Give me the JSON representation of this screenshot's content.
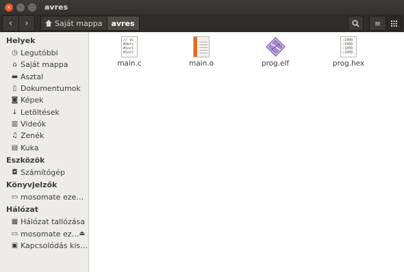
{
  "window": {
    "title": "avres",
    "close_glyph": "×",
    "minimize_glyph": "–",
    "maximize_glyph": "▢"
  },
  "toolbar": {
    "back_icon": "‹",
    "forward_icon": "›",
    "breadcrumbs": [
      "Saját mappa",
      "avres"
    ],
    "search_icon": "search-icon",
    "list_view_glyph": "≡",
    "grid_view_glyph": "⋮⋮"
  },
  "sidebar": {
    "sections": [
      {
        "title": "Helyek",
        "items": [
          {
            "label": "Legutóbbi",
            "icon": "clock-icon",
            "glyph": "◷"
          },
          {
            "label": "Saját mappa",
            "icon": "home-icon",
            "glyph": "⌂"
          },
          {
            "label": "Asztal",
            "icon": "desktop-icon",
            "glyph": "▬"
          },
          {
            "label": "Dokumentumok",
            "icon": "document-icon",
            "glyph": "▯"
          },
          {
            "label": "Képek",
            "icon": "camera-icon",
            "glyph": "◙"
          },
          {
            "label": "Letöltések",
            "icon": "download-icon",
            "glyph": "↓"
          },
          {
            "label": "Videók",
            "icon": "film-icon",
            "glyph": "▥"
          },
          {
            "label": "Zenék",
            "icon": "music-icon",
            "glyph": "♫"
          },
          {
            "label": "Kuka",
            "icon": "trash-icon",
            "glyph": "▤"
          }
        ]
      },
      {
        "title": "Eszközök",
        "items": [
          {
            "label": "Számítógép",
            "icon": "drive-icon",
            "glyph": "◘"
          }
        ]
      },
      {
        "title": "Könyvjelzők",
        "items": [
          {
            "label": "mosomate ezen: m…",
            "icon": "folder-icon",
            "glyph": "▭"
          }
        ]
      },
      {
        "title": "Hálózat",
        "items": [
          {
            "label": "Hálózat tallózása",
            "icon": "network-icon",
            "glyph": "▦"
          },
          {
            "label": "mosomate ez…",
            "icon": "folder-icon",
            "glyph": "▭",
            "eject": "⏏"
          },
          {
            "label": "Kapcsolódás kiszo…",
            "icon": "server-icon",
            "glyph": "▣"
          }
        ]
      }
    ]
  },
  "files": [
    {
      "name": "main.c",
      "type": "c-source",
      "preview": "// Vi\n#defi\n#incl\n#incl"
    },
    {
      "name": "main.o",
      "type": "object"
    },
    {
      "name": "prog.elf",
      "type": "executable"
    },
    {
      "name": "prog.hex",
      "type": "hex",
      "preview": ":1000\n:1000\n:1000\n:1000"
    }
  ],
  "colors": {
    "titlebar": "#3c3b37",
    "close_button": "#e9562a",
    "sidebar_bg": "#edecea",
    "object_band": "#e16b2a",
    "elf_purple": "#7e5bb5"
  }
}
